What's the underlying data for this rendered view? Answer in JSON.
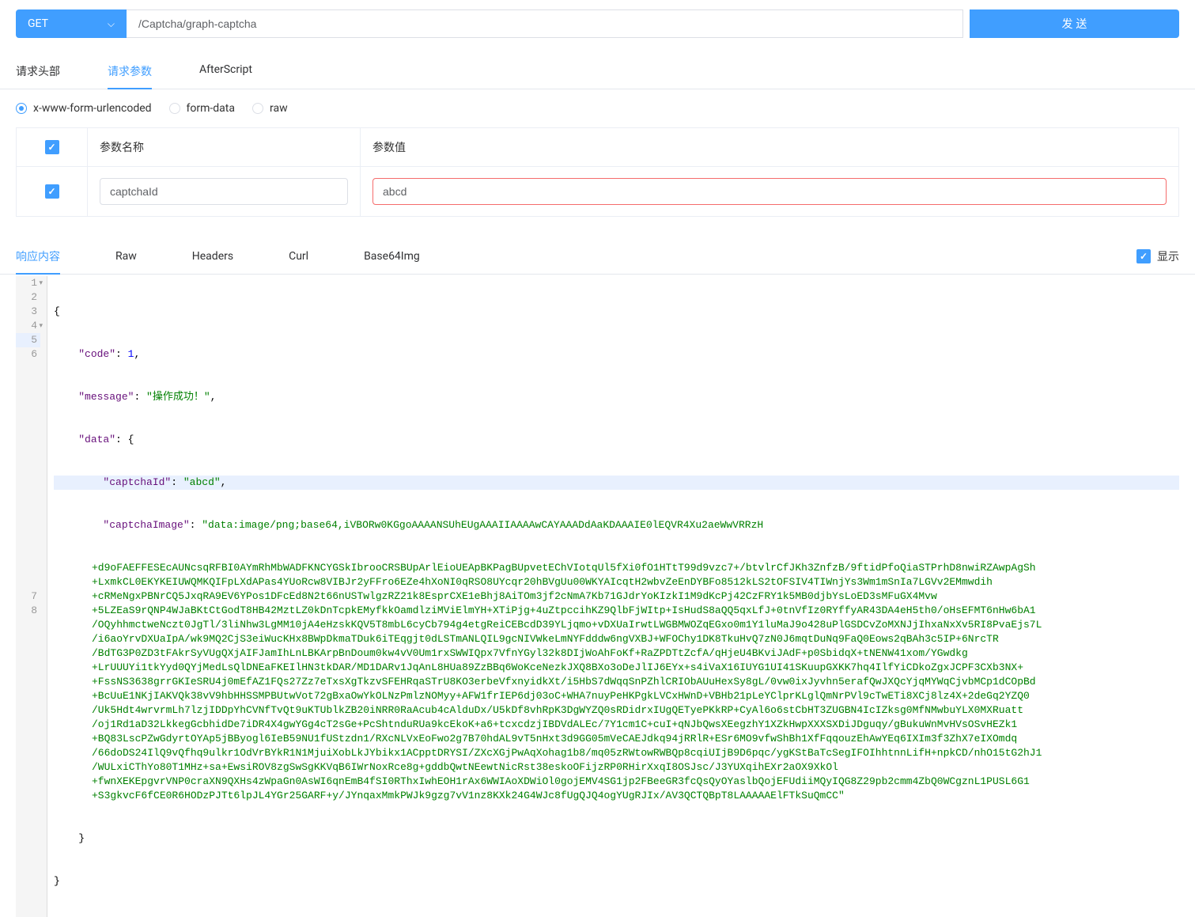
{
  "request": {
    "method": "GET",
    "url": "/Captcha/graph-captcha",
    "send_label": "发 送"
  },
  "request_tabs": {
    "header": "请求头部",
    "params": "请求参数",
    "afterscript": "AfterScript"
  },
  "body_types": {
    "urlencoded": "x-www-form-urlencoded",
    "formdata": "form-data",
    "raw": "raw"
  },
  "params_table": {
    "header_name": "参数名称",
    "header_value": "参数值",
    "rows": [
      {
        "checked": true,
        "name": "captchaId",
        "value": "abcd"
      }
    ]
  },
  "response_tabs": {
    "content": "响应内容",
    "raw": "Raw",
    "headers": "Headers",
    "curl": "Curl",
    "base64": "Base64Img"
  },
  "show_label": "显示",
  "response_body": {
    "line1": "{",
    "line2_key": "\"code\"",
    "line2_val": "1",
    "line3_key": "\"message\"",
    "line3_val": "\"操作成功！\"",
    "line4_key": "\"data\"",
    "line4_val": "{",
    "line5_key": "\"captchaId\"",
    "line5_val": "\"abcd\"",
    "line6_key": "\"captchaImage\"",
    "line6_prefix": "\"data:image/png;base64,iVBORw0KGgoAAAANSUhEUgAAAIIAAAAwCAYAAADdAaKDAAAIE0lEQVR4Xu2aeWwVRRzH",
    "line6_body": "+d9oFAEFFESEcAUNcsqRFBI0AYmRhMbWADFKNCYGSkIbrooCRSBUpArlEioUEApBKPagBUpvetEChVIotqUl5fXi0fO1HTtT99d9vzc7+/btvlrCfJKh3ZnfzB/9ftidPfoQiaSTPrhD8nwiRZAwpAgSh\n+LxmkCL0EKYKEIUWQMKQIFpLXdAPas4YUoRcw8VIBJr2yFFro6EZe4hXoNI0qRSO8UYcqr20hBVgUu00WKYAIcqtH2wbvZeEnDYBFo8512kLS2tOFSIV4TIWnjYs3Wm1mSnIa7LGVv2EMmwdih\n+cRMeNgxPBNrCQ5JxqRA9EV6YPos1DFcEd8N2t66nUSTwlgzRZ21k8EsprCXE1eBhj8AiTOm3jf2cNmA7Kb71GJdrYoKIzkI1M9dKcPj42CzFRY1k5MB0djbYsLoED3sMFuGX4Mvw\n+5LZEaS9rQNP4WJaBKtCtGodT8HB42MztLZ0kDnTcpkEMyfkkOamdlziMViElmYH+XTiPjg+4uZtpccihKZ9QlbFjWItp+IsHudS8aQQ5qxLfJ+0tnVfIz0RYffyAR43DA4eH5th0/oHsEFMT6nHw6bA1\n/OQyhhmctweNczt0JgTl/3liNhw3LgMM10jA4eHzskKQV5T8mbL6cyCb794g4etgReiCEBcdD39YLjqmo+vDXUaIrwtLWGBMWOZqEGxo0m1Y1luMaJ9o428uPlGSDCvZoMXNJjIhxaNxXv5RI8PvaEjs7L\n/i6aoYrvDXUaIpA/wk9MQ2CjS3eiWucKHx8BWpDkmaTDuk6iTEqgjt0dLSTmANLQIL9gcNIVWkeLmNYFdddw6ngVXBJ+WFOChy1DK8TkuHvQ7zN0J6mqtDuNq9FaQ0Eows2qBAh3c5IP+6NrcTR\n/BdTG3P0ZD3tFAkrSyVUgQXjAIFJamIhLnLBKArpBnDoum0kw4vV0Um1rxSWWIQpx7VfnYGyl32k8DIjWoAhFoKf+RaZPDTtZcfA/qHjeU4BKviJAdF+p0SbidqX+tNENW41xom/YGwdkg\n+LrUUUYi1tkYyd0QYjMedLsQlDNEaFKEIlHN3tkDAR/MD1DARv1JqAnL8HUa89ZzBBq6WoKceNezkJXQ8BXo3oDeJlIJ6EYx+s4iVaX16IUYG1UI41SKuupGXKK7hq4IlfYiCDkoZgxJCPF3CXb3NX+\n+FssNS3638grrGKIeSRU4j0mEfAZ1FQs27Zz7eTxsXgTkzvSFEHRqaSTrU8KO3erbeVfxnyidkXt/i5HbS7dWqqSnPZhlCRIObAUuHexSy8gL/0vw0ixJyvhn5erafQwJXQcYjqMYWqCjvbMCp1dCOpBd\n+BcUuE1NKjIAKVQk38vV9hbHHSSMPBUtwVot72gBxaOwYkOLNzPmlzNOMyy+AFW1frIEP6dj03oC+WHA7nuyPeHKPgkLVCxHWnD+VBHb21pLeYClprKLglQmNrPVl9cTwETi8XCj8lz4X+2deGq2YZQ0\n/Uk5Hdt4wrvrmLh7lzjIDDpYhCVNfTvQt9uKTUblkZB20iNRR0RaAcub4cAlduDx/U5kDf8vhRpK3DgWYZQ0sRDidrxIUgQETyePKkRP+CyAl6o6stCbHT3ZUGBN4IcIZksg0MfNMwbuYLX0MXRuatt\n/oj1Rd1aD32LkkegGcbhidDe7iDR4X4gwYGg4cT2sGe+PcShtnduRUa9kcEkoK+a6+tcxcdzjIBDVdALEc/7Y1cm1C+cuI+qNJbQwsXEegzhY1XZkHwpXXXSXDiJDguqy/gBukuWnMvHVsOSvHEZk1\n+BQ83LscPZwGdyrtOYAp5jBByogl6IeB59NU1fUStzdn1/RXcNLVxEoFwo2g7B70hdAL9vT5nHxt3d9GG05mVeCAEJdkq94jRRlR+ESr6MO9vfwShBh1XfFqqouzEhAwYEq6IXIm3f3ZhX7eIXOmdq\n/66doDS24IlQ9vQfhq9ulkr1OdVrBYkR1N1MjuiXobLkJYbikx1ACpptDRYSI/ZXcXGjPwAqXohag1b8/mq05zRWtowRWBQp8cqiUIjB9D6pqc/ygKStBaTcSegIFOIhhtnnLifH+npkCD/nhO15tG2hJ1\n/WULxiCThYo80T1MHz+sa+EwsiROV8zgSwSgKKVqB6IWrNoxRce8g+gddbQwtNEewtNicRst38eskoOFijzRP0RHirXxqI8OSJsc/J3YUXqihEXr2aOX9XkOl\n+fwnXEKEpgvrVNP0craXN9QXHs4zWpaGn0AsWI6qnEmB4fSI0RThxIwhEOH1rAx6WWIAoXDWiOl0gojEMV4SG1jp2FBeeGR3fcQsQyOYaslbQojEFUdiiMQyIQG8Z29pb2cmm4ZbQ0WCgznL1PUSL6G1\n+S3gkvcF6fCE0R6HODzPJTt6lpJL4YGr25GARF+y/JYnqaxMmkPWJk9gzg7vV1nz8KXk24G4WJc8fUgQJQ4ogYUgRJIx/AV3QCTQBpT8LAAAAAElFTkSuQmCC\"",
    "line7": "    }",
    "line8": "}"
  }
}
